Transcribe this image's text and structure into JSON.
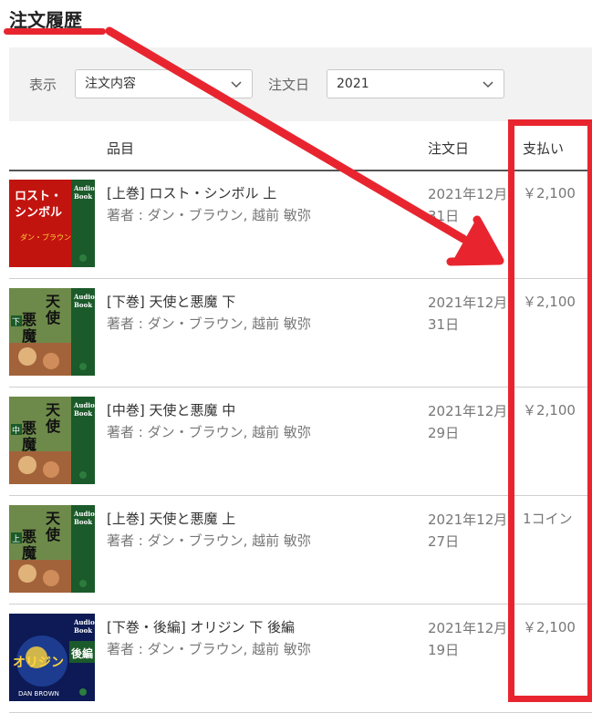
{
  "header": {
    "title": "注文履歴"
  },
  "filters": {
    "display_label": "表示",
    "display_value": "注文内容",
    "date_label": "注文日",
    "date_value": "2021"
  },
  "table": {
    "columns": {
      "item": "品目",
      "date": "注文日",
      "payment": "支払い"
    },
    "rows": [
      {
        "title": "[上巻] ロスト・シンボル 上",
        "author": "著者 : ダン・ブラウン, 越前 敏弥",
        "date_line1": "2021年12月",
        "date_line2": "31日",
        "payment": "￥2,100",
        "cover": {
          "icon": "book-cover",
          "bg": "#b8120f",
          "title": "ロスト・シンボル",
          "author": "ダン・ブラウン",
          "badge": "Audio Book"
        }
      },
      {
        "title": "[下巻] 天使と悪魔 下",
        "author": "著者 : ダン・ブラウン, 越前 敏弥",
        "date_line1": "2021年12月",
        "date_line2": "31日",
        "payment": "￥2,100",
        "cover": {
          "icon": "book-cover",
          "bg": "#1e4f25",
          "title": "天使と悪魔",
          "volume": "下",
          "badge": "Audio Book"
        }
      },
      {
        "title": "[中巻] 天使と悪魔 中",
        "author": "著者 : ダン・ブラウン, 越前 敏弥",
        "date_line1": "2021年12月",
        "date_line2": "29日",
        "payment": "￥2,100",
        "cover": {
          "icon": "book-cover",
          "bg": "#1e4f25",
          "title": "天使と悪魔",
          "volume": "中",
          "badge": "Audio Book"
        }
      },
      {
        "title": "[上巻] 天使と悪魔 上",
        "author": "著者 : ダン・ブラウン, 越前 敏弥",
        "date_line1": "2021年12月",
        "date_line2": "27日",
        "payment": "1コイン",
        "cover": {
          "icon": "book-cover",
          "bg": "#1e4f25",
          "title": "天使と悪魔",
          "volume": "上",
          "badge": "Audio Book"
        }
      },
      {
        "title": "[下巻・後編] オリジン 下 後編",
        "author": "著者 : ダン・ブラウン, 越前 敏弥",
        "date_line1": "2021年12月",
        "date_line2": "19日",
        "payment": "￥2,100",
        "cover": {
          "icon": "book-cover",
          "bg": "#0d1a55",
          "title": "オリジン",
          "volume": "下",
          "sub": "後編",
          "badge": "Audio Book"
        }
      }
    ]
  },
  "annotation": {
    "color": "#e8252f"
  }
}
